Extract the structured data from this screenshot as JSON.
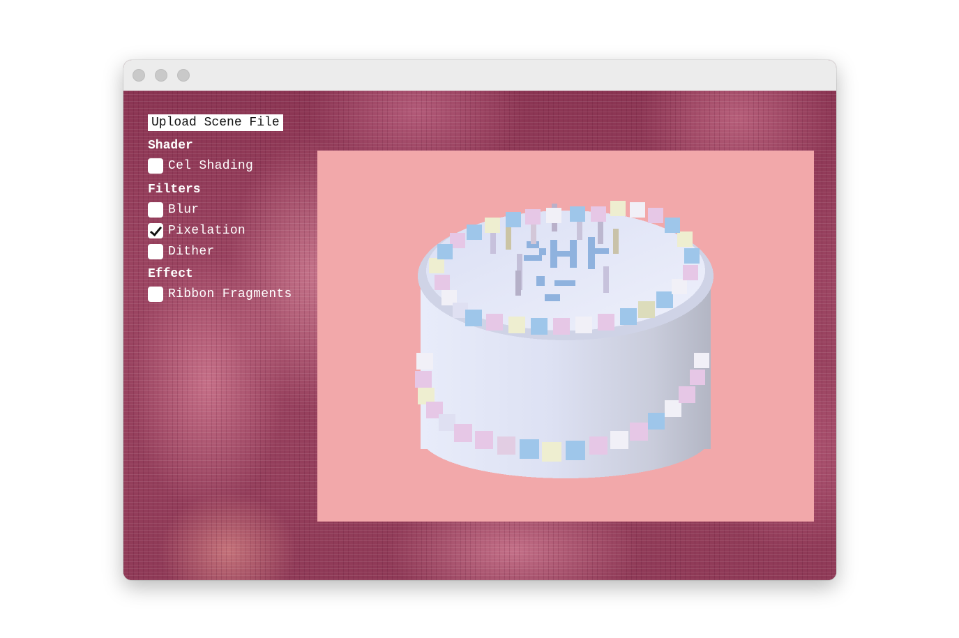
{
  "window": {
    "traffic_lights": [
      "close",
      "minimize",
      "maximize"
    ]
  },
  "controls": {
    "upload_button_label": "Upload Scene File",
    "sections": [
      {
        "title": "Shader",
        "options": [
          {
            "label": "Cel Shading",
            "checked": false
          }
        ]
      },
      {
        "title": "Filters",
        "options": [
          {
            "label": "Blur",
            "checked": false
          },
          {
            "label": "Pixelation",
            "checked": true
          },
          {
            "label": "Dither",
            "checked": false
          }
        ]
      },
      {
        "title": "Effect",
        "options": [
          {
            "label": "Ribbon Fragments",
            "checked": false
          }
        ]
      }
    ]
  },
  "scene": {
    "background_color": "#f2a8aa",
    "subject": "pixelated-cake-icon",
    "cake_colors": {
      "frosting": "#dfe3f5",
      "side_light": "#e4e8f8",
      "side_shadow": "#b9bccb",
      "pearl_blue": "#9ec6ea",
      "pearl_pink": "#e6c7e6",
      "pearl_cream": "#eeeed0",
      "pearl_white": "#f1f0f7",
      "candle_lavender": "#c9c3dd",
      "writing_blue": "#8fb2de"
    }
  },
  "theme": {
    "background": "#7d2b48",
    "titlebar": "#ececec",
    "text": "#ffffff"
  }
}
